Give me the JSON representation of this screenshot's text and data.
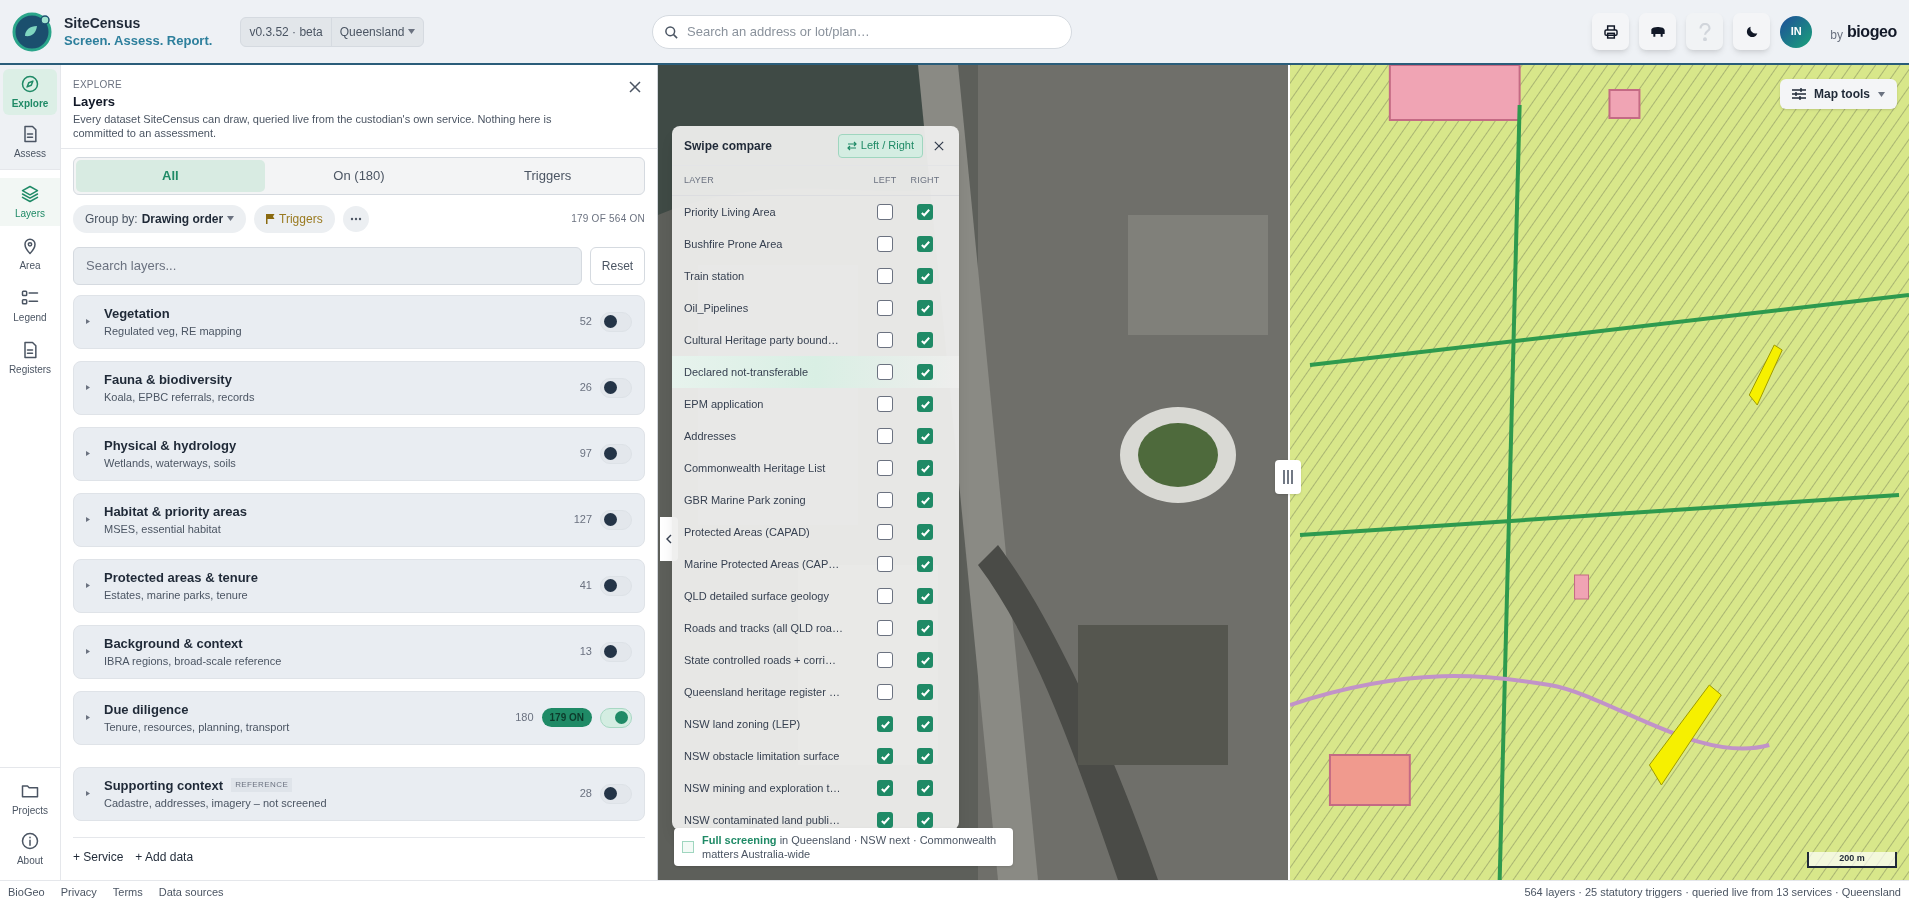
{
  "app": {
    "name": "SiteCensus",
    "tagline": "Screen. Assess. Report.",
    "version": "v0.3.52 · beta",
    "region": "Queensland"
  },
  "search": {
    "placeholder": "Search an address or lot/plan…"
  },
  "toolbar": [
    {
      "kind": "print",
      "disabled": false
    },
    {
      "kind": "animal",
      "disabled": false
    },
    {
      "kind": "help",
      "disabled": true
    },
    {
      "kind": "dark",
      "disabled": false
    }
  ],
  "avatar": "IN",
  "brand": {
    "by": "by",
    "name": "biogeo"
  },
  "nav_modes": [
    {
      "label": "Explore",
      "selected": true
    },
    {
      "label": "Assess",
      "selected": false
    }
  ],
  "nav_tools": [
    {
      "label": "Layers",
      "selected": true
    },
    {
      "label": "Area",
      "selected": false
    },
    {
      "label": "Legend",
      "selected": false
    },
    {
      "label": "Registers",
      "selected": false
    }
  ],
  "nav_bottom": [
    {
      "label": "Projects"
    },
    {
      "label": "About"
    }
  ],
  "panel": {
    "eyebrow": "EXPLORE",
    "title": "Layers",
    "description": "Every dataset SiteCensus can draw, queried live from the custodian's own service. Nothing here is committed to an assessment."
  },
  "tabs": [
    {
      "label": "All",
      "selected": true
    },
    {
      "label": "On (180)",
      "selected": false
    },
    {
      "label": "Triggers",
      "selected": false
    }
  ],
  "filters": {
    "group_by_label": "Group by:",
    "group_by_value": "Drawing order",
    "triggers": "Triggers",
    "count": "179 OF 564 ON"
  },
  "layer_search": {
    "placeholder": "Search layers...",
    "reset": "Reset"
  },
  "groups": [
    {
      "title": "Vegetation",
      "subtitle": "Regulated veg, RE mapping",
      "count": "52",
      "on": false
    },
    {
      "title": "Fauna & biodiversity",
      "subtitle": "Koala, EPBC referrals, records",
      "count": "26",
      "on": false
    },
    {
      "title": "Physical & hydrology",
      "subtitle": "Wetlands, waterways, soils",
      "count": "97",
      "on": false
    },
    {
      "title": "Habitat & priority areas",
      "subtitle": "MSES, essential habitat",
      "count": "127",
      "on": false
    },
    {
      "title": "Protected areas & tenure",
      "subtitle": "Estates, marine parks, tenure",
      "count": "41",
      "on": false
    },
    {
      "title": "Background & context",
      "subtitle": "IBRA regions, broad-scale reference",
      "count": "13",
      "on": false
    },
    {
      "title": "Due diligence",
      "subtitle": "Tenure, resources, planning, transport",
      "count": "180",
      "badge": "179 ON",
      "on": true
    },
    {
      "title": "Supporting context",
      "tag": "REFERENCE",
      "subtitle": "Cadastre, addresses, imagery – not screened",
      "count": "28",
      "on": false
    }
  ],
  "panel_actions": [
    "+ Service",
    "+ Add data"
  ],
  "swipe": {
    "title": "Swipe compare",
    "mode": "Left / Right",
    "columns": [
      "LAYER",
      "LEFT",
      "RIGHT"
    ],
    "rows": [
      {
        "name": "Priority Living Area",
        "left": false,
        "right": true,
        "hovered": false
      },
      {
        "name": "Bushfire Prone Area",
        "left": false,
        "right": true,
        "hovered": false
      },
      {
        "name": "Train station",
        "left": false,
        "right": true,
        "hovered": false
      },
      {
        "name": "Oil_Pipelines",
        "left": false,
        "right": true,
        "hovered": false
      },
      {
        "name": "Cultural Heritage party bound…",
        "left": false,
        "right": true,
        "hovered": false
      },
      {
        "name": "Declared not-transferable",
        "left": false,
        "right": true,
        "hovered": true
      },
      {
        "name": "EPM application",
        "left": false,
        "right": true,
        "hovered": false
      },
      {
        "name": "Addresses",
        "left": false,
        "right": true,
        "hovered": false
      },
      {
        "name": "Commonwealth Heritage List",
        "left": false,
        "right": true,
        "hovered": false
      },
      {
        "name": "GBR Marine Park zoning",
        "left": false,
        "right": true,
        "hovered": false
      },
      {
        "name": "Protected Areas (CAPAD)",
        "left": false,
        "right": true,
        "hovered": false
      },
      {
        "name": "Marine Protected Areas (CAP…",
        "left": false,
        "right": true,
        "hovered": false
      },
      {
        "name": "QLD detailed surface geology",
        "left": false,
        "right": true,
        "hovered": false
      },
      {
        "name": "Roads and tracks (all QLD roa…",
        "left": false,
        "right": true,
        "hovered": false
      },
      {
        "name": "State controlled roads + corri…",
        "left": false,
        "right": true,
        "hovered": false
      },
      {
        "name": "Queensland heritage register …",
        "left": false,
        "right": true,
        "hovered": false
      },
      {
        "name": "NSW land zoning (LEP)",
        "left": true,
        "right": true,
        "hovered": false
      },
      {
        "name": "NSW obstacle limitation surface",
        "left": true,
        "right": true,
        "hovered": false
      },
      {
        "name": "NSW mining and exploration t…",
        "left": true,
        "right": true,
        "hovered": false
      },
      {
        "name": "NSW contaminated land publi…",
        "left": true,
        "right": true,
        "hovered": false
      }
    ]
  },
  "screening": {
    "checked": false,
    "text": "**Full screening** in Queensland · NSW next · Commonwealth matters Australia-wide"
  },
  "map_tools": "Map tools",
  "scale": "200 m",
  "footer": {
    "links": [
      "BioGeo",
      "Privacy",
      "Terms",
      "Data sources"
    ],
    "status": "564 layers · 25 statutory triggers · queried live from 13 services · Queensland"
  }
}
